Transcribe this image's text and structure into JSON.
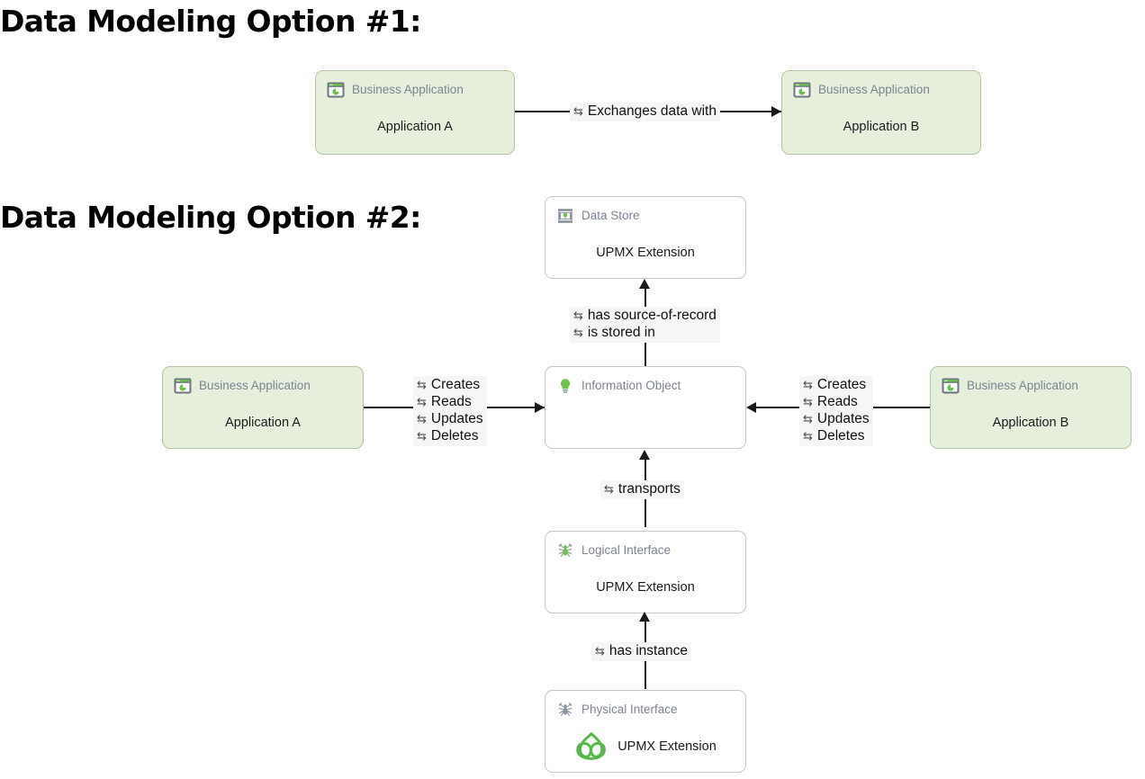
{
  "headings": {
    "option1": "Data Modeling Option #1:",
    "option2": "Data Modeling Option #2:"
  },
  "glyphs": {
    "swap": "⇆"
  },
  "option1": {
    "nodes": [
      {
        "type": "Business Application",
        "name": "Application A",
        "icon": "business-application-icon"
      },
      {
        "type": "Business Application",
        "name": "Application B",
        "icon": "business-application-icon"
      }
    ],
    "edges": [
      {
        "label": "Exchanges data with"
      }
    ]
  },
  "option2": {
    "nodes": [
      {
        "type": "Data Store",
        "name": "UPMX Extension",
        "icon": "data-store-icon"
      },
      {
        "type": "Information Object",
        "name": "",
        "icon": "information-object-icon"
      },
      {
        "type": "Business Application",
        "name": "Application A",
        "icon": "business-application-icon"
      },
      {
        "type": "Business Application",
        "name": "Application B",
        "icon": "business-application-icon"
      },
      {
        "type": "Logical Interface",
        "name": "UPMX Extension",
        "icon": "logical-interface-icon"
      },
      {
        "type": "Physical Interface",
        "name": "UPMX Extension",
        "icon": "physical-interface-icon"
      }
    ],
    "edges": {
      "store": [
        "has source-of-record",
        "is stored in"
      ],
      "crud_left": [
        "Creates",
        "Reads",
        "Updates",
        "Deletes"
      ],
      "crud_right": [
        "Creates",
        "Reads",
        "Updates",
        "Deletes"
      ],
      "transports": [
        "transports"
      ],
      "has_instance": [
        "has instance"
      ]
    }
  },
  "colors": {
    "card_green_fill": "#e6efdc",
    "card_green_border": "#b5c4a5",
    "card_plain_border": "#c8c8c8",
    "accent_green": "#5cb85c",
    "type_text": "#7c8491",
    "label_bg": "#f6f6f7"
  }
}
